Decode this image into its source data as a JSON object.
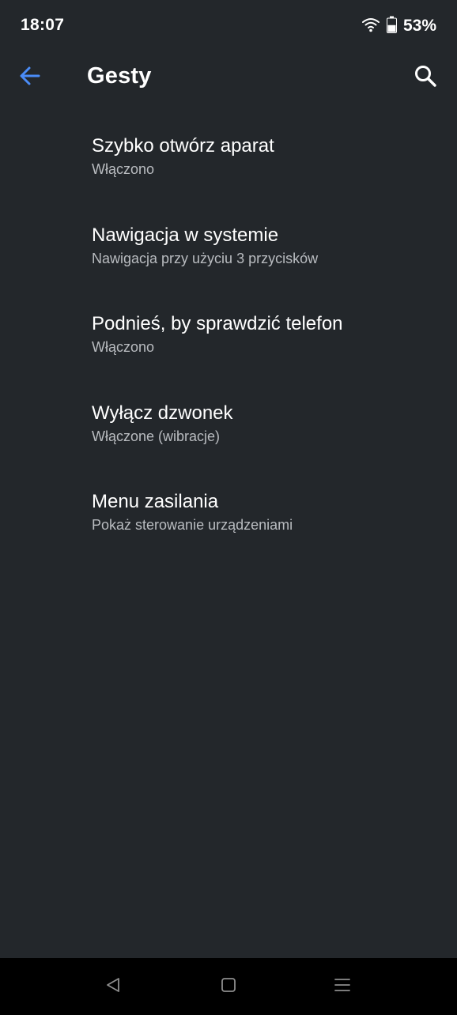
{
  "status_bar": {
    "time": "18:07",
    "battery_percent": "53%",
    "wifi_icon": "wifi-icon",
    "battery_icon": "battery-icon",
    "battery_level": 0.53
  },
  "app_bar": {
    "title": "Gesty",
    "back_icon": "arrow-left-icon",
    "search_icon": "search-icon",
    "accent_color": "#4a8cf7"
  },
  "settings": {
    "items": [
      {
        "title": "Szybko otwórz aparat",
        "summary": "Włączono"
      },
      {
        "title": "Nawigacja w systemie",
        "summary": "Nawigacja przy użyciu 3 przycisków"
      },
      {
        "title": "Podnieś, by sprawdzić telefon",
        "summary": "Włączono"
      },
      {
        "title": "Wyłącz dzwonek",
        "summary": "Włączone (wibracje)"
      },
      {
        "title": "Menu zasilania",
        "summary": "Pokaż sterowanie urządzeniami"
      }
    ]
  },
  "nav_bar": {
    "back_icon": "triangle-back-icon",
    "home_icon": "square-home-icon",
    "menu_icon": "menu-lines-icon"
  }
}
